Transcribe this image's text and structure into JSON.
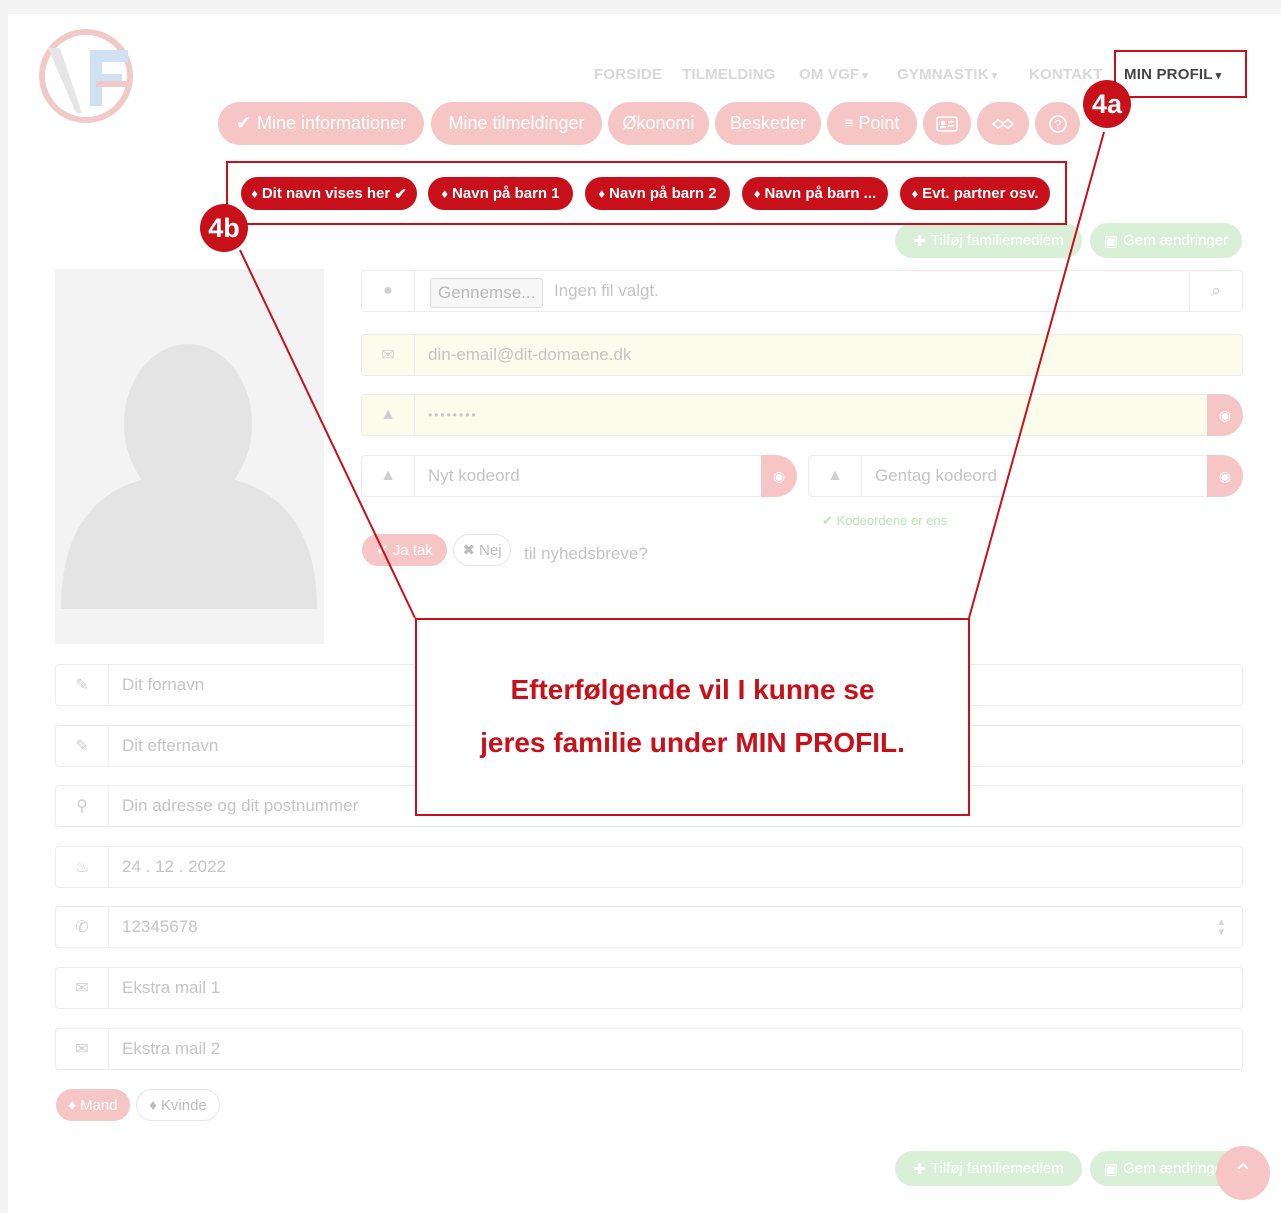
{
  "nav": {
    "items": [
      {
        "label": "FORSIDE",
        "has_dropdown": false
      },
      {
        "label": "TILMELDING",
        "has_dropdown": false
      },
      {
        "label": "OM VGF",
        "has_dropdown": true
      },
      {
        "label": "GYMNASTIK",
        "has_dropdown": true
      },
      {
        "label": "KONTAKT",
        "has_dropdown": false
      },
      {
        "label": "MIN PROFIL",
        "has_dropdown": true,
        "active": true
      }
    ],
    "chevron": "▾"
  },
  "profile_tabs": {
    "mine_informationer": "Mine informationer",
    "mine_tilmeldinger": "Mine tilmeldinger",
    "okonomi": "Økonomi",
    "beskeder": "Beskeder",
    "point": "Point",
    "icons": [
      "id-card-icon",
      "handshake-icon",
      "help-icon"
    ]
  },
  "family_members": [
    "Dit navn vises her",
    "Navn på barn 1",
    "Navn på barn 2",
    "Navn på barn ...",
    "Evt. partner osv."
  ],
  "actions": {
    "add_family": "Tilføj familiemedlem",
    "save": "Gem ændringer"
  },
  "upload": {
    "button": "Gennemse...",
    "status": "Ingen fil valgt."
  },
  "fields": {
    "email_value": "din-email@dit-domaene.dk",
    "password_value": "••••••••",
    "new_password_placeholder": "Nyt kodeord",
    "repeat_password_placeholder": "Gentag kodeord",
    "password_match": "Kodeordene er ens",
    "firstname_placeholder": "Dit fornavn",
    "lastname_placeholder": "Dit efternavn",
    "address_placeholder": "Din adresse og dit postnummer",
    "birthday_value": "24 . 12 . 2022",
    "phone_value": "12345678",
    "extra_mail_1": "Ekstra mail 1",
    "extra_mail_2": "Ekstra mail 2"
  },
  "newsletter": {
    "yes": "Ja tak",
    "no": "Nej",
    "question": "til nyhedsbreve?"
  },
  "gender": {
    "male": "Mand",
    "female": "Kvinde"
  },
  "annotations": {
    "badge_4a": "4a",
    "badge_4b": "4b",
    "callout_line1": "Efterfølgende vil I kunne se",
    "callout_line2": "jeres familie under MIN PROFIL."
  },
  "colors": {
    "brand_red": "#c8101a",
    "faded_red": "#f6c6c6",
    "faded_green": "#d9efd7",
    "input_yellow": "#fcfcec"
  }
}
